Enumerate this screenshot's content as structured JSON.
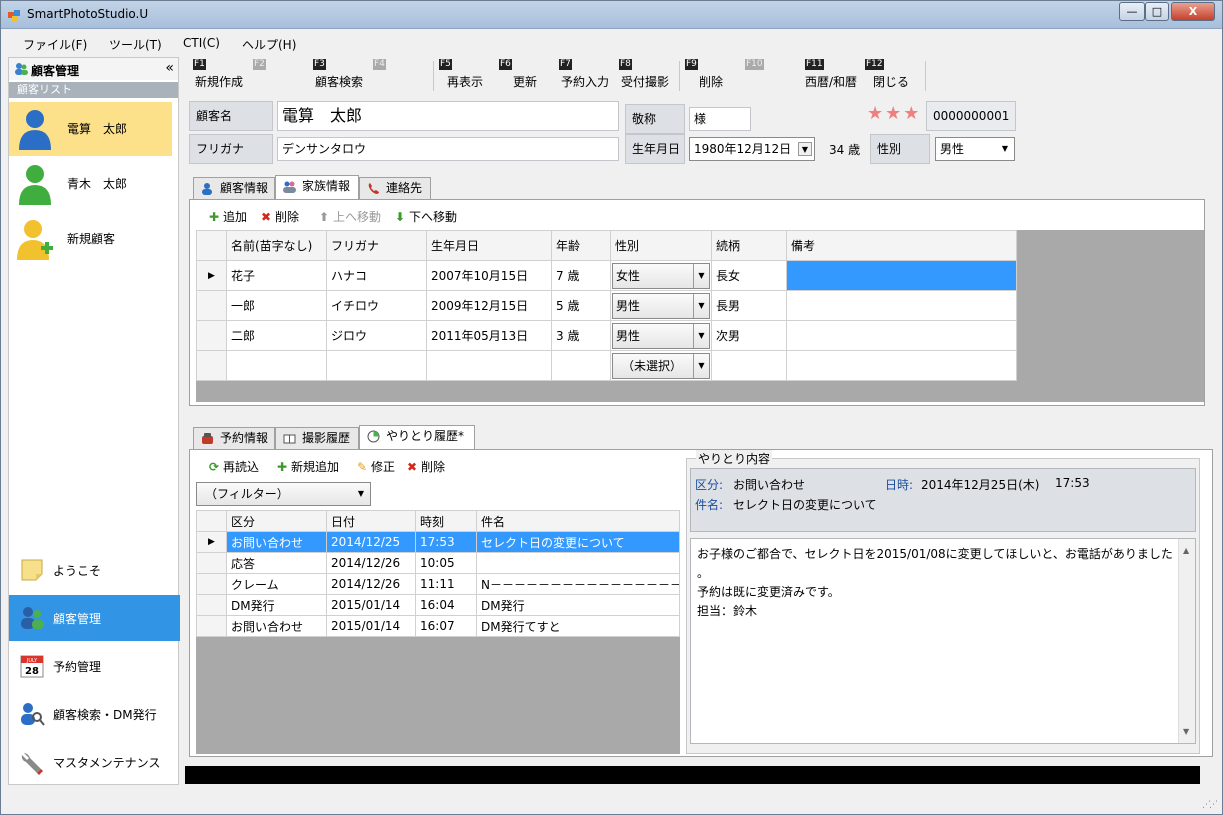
{
  "window": {
    "title": "SmartPhotoStudio.U",
    "min": "—",
    "max": "□",
    "close": "X"
  },
  "menu": [
    "ファイル(F)",
    "ツール(T)",
    "CTI(C)",
    "ヘルプ(H)"
  ],
  "sidebar": {
    "header": "顧客管理",
    "collapse": "«",
    "sub": "顧客リスト",
    "customers": [
      {
        "name": "電算　太郎"
      },
      {
        "name": "青木　太郎"
      },
      {
        "name": "新規顧客"
      }
    ],
    "nav": [
      {
        "label": "ようこそ"
      },
      {
        "label": "顧客管理"
      },
      {
        "label": "予約管理"
      },
      {
        "label": "顧客検索・DM発行"
      },
      {
        "label": "マスタメンテナンス"
      }
    ],
    "calendar_day": "28",
    "calendar_month": "JULY"
  },
  "fkeys": [
    {
      "key": "F1",
      "label": "新規作成"
    },
    {
      "key": "F2",
      "label": ""
    },
    {
      "key": "F3",
      "label": "顧客検索"
    },
    {
      "key": "F4",
      "label": ""
    },
    {
      "key": "F5",
      "label": "再表示"
    },
    {
      "key": "F6",
      "label": "更新"
    },
    {
      "key": "F7",
      "label": "予約入力"
    },
    {
      "key": "F8",
      "label": "受付撮影"
    },
    {
      "key": "F9",
      "label": "削除"
    },
    {
      "key": "F10",
      "label": ""
    },
    {
      "key": "F11",
      "label": "西暦/和暦"
    },
    {
      "key": "F12",
      "label": "閉じる"
    }
  ],
  "customer": {
    "name_label": "顧客名",
    "name_value": "電算　太郎",
    "kana_label": "フリガナ",
    "kana_value": "デンサンタロウ",
    "honorific_label": "敬称",
    "honorific_value": "様",
    "birth_label": "生年月日",
    "birth_value": "1980年12月12日",
    "age": "34 歳",
    "gender_label": "性別",
    "gender_value": "男性",
    "stars": "★★★",
    "customer_no": "0000000001"
  },
  "upper_tabs": [
    "顧客情報",
    "家族情報",
    "連絡先"
  ],
  "family_toolbar": {
    "add": "追加",
    "delete": "削除",
    "up": "上へ移動",
    "down": "下へ移動"
  },
  "family": {
    "headers": [
      "名前(苗字なし)",
      "フリガナ",
      "生年月日",
      "年齢",
      "性別",
      "続柄",
      "備考"
    ],
    "rows": [
      {
        "name": "花子",
        "kana": "ハナコ",
        "birth": "2007年10月15日",
        "age": "7 歳",
        "gender": "女性",
        "relation": "長女",
        "note": ""
      },
      {
        "name": "一郎",
        "kana": "イチロウ",
        "birth": "2009年12月15日",
        "age": "5 歳",
        "gender": "男性",
        "relation": "長男",
        "note": ""
      },
      {
        "name": "二郎",
        "kana": "ジロウ",
        "birth": "2011年05月13日",
        "age": "3 歳",
        "gender": "男性",
        "relation": "次男",
        "note": ""
      },
      {
        "name": "",
        "kana": "",
        "birth": "",
        "age": "",
        "gender": "（未選択）",
        "relation": "",
        "note": ""
      }
    ]
  },
  "lower_tabs": [
    "予約情報",
    "撮影履歴",
    "やりとり履歴*"
  ],
  "history_toolbar": {
    "reload": "再読込",
    "new": "新規追加",
    "edit": "修正",
    "delete": "削除"
  },
  "history_filter": "（フィルター）",
  "history": {
    "headers": [
      "区分",
      "日付",
      "時刻",
      "件名"
    ],
    "rows": [
      {
        "type": "お問い合わせ",
        "date": "2014/12/25",
        "time": "17:53",
        "subject": "セレクト日の変更について"
      },
      {
        "type": "応答",
        "date": "2014/12/26",
        "time": "10:05",
        "subject": ""
      },
      {
        "type": "クレーム",
        "date": "2014/12/26",
        "time": "11:11",
        "subject": "N－－－－－－－－－－－－－－－－－－…"
      },
      {
        "type": "DM発行",
        "date": "2015/01/14",
        "time": "16:04",
        "subject": "DM発行"
      },
      {
        "type": "お問い合わせ",
        "date": "2015/01/14",
        "time": "16:07",
        "subject": "DM発行てすと"
      }
    ]
  },
  "detail": {
    "group_title": "やりとり内容",
    "type_label": "区分:",
    "type_value": "お問い合わせ",
    "datetime_label": "日時:",
    "datetime_value": "2014年12月25日(木)",
    "time_value": "17:53",
    "subject_label": "件名:",
    "subject_value": "セレクト日の変更について",
    "memo_line1": "お子様のご都合で、セレクト日を2015/01/08に変更してほしいと、お電話がありました",
    "memo_line2": "。",
    "memo_line3": "予約は既に変更済みです。",
    "memo_line4": "担当：鈴木"
  },
  "colors": {
    "accent": "#3294e4",
    "selected_customer": "#fde08a",
    "grid_select": "#3399ff",
    "stars": "#f08080"
  }
}
